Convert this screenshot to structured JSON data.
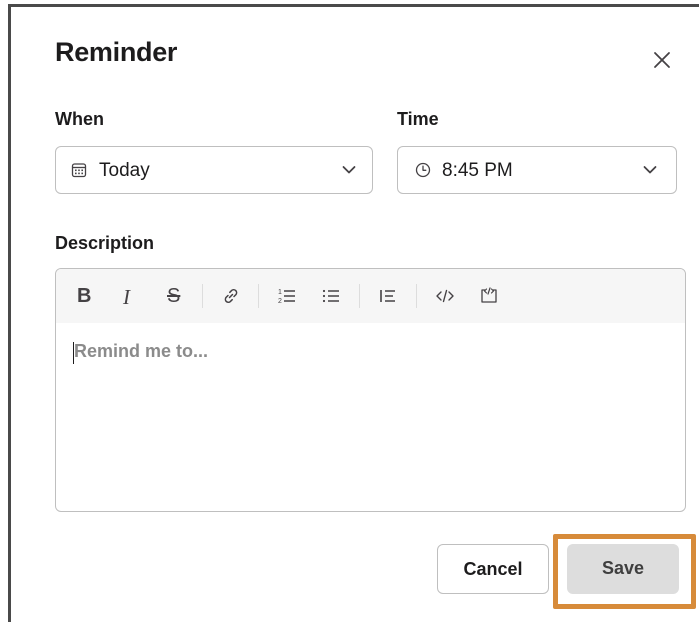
{
  "dialog": {
    "title": "Reminder"
  },
  "when": {
    "label": "When",
    "value": "Today",
    "icon": "calendar-icon"
  },
  "time": {
    "label": "Time",
    "value": "8:45 PM",
    "icon": "clock-icon"
  },
  "description": {
    "label": "Description",
    "placeholder": "Remind me to...",
    "toolbar": {
      "bold": "B",
      "italic": "I",
      "strike": "S"
    }
  },
  "buttons": {
    "cancel": "Cancel",
    "save": "Save"
  },
  "colors": {
    "highlight": "#d78b3a",
    "save_bg": "#dddddd",
    "border": "#bfbfbf"
  }
}
